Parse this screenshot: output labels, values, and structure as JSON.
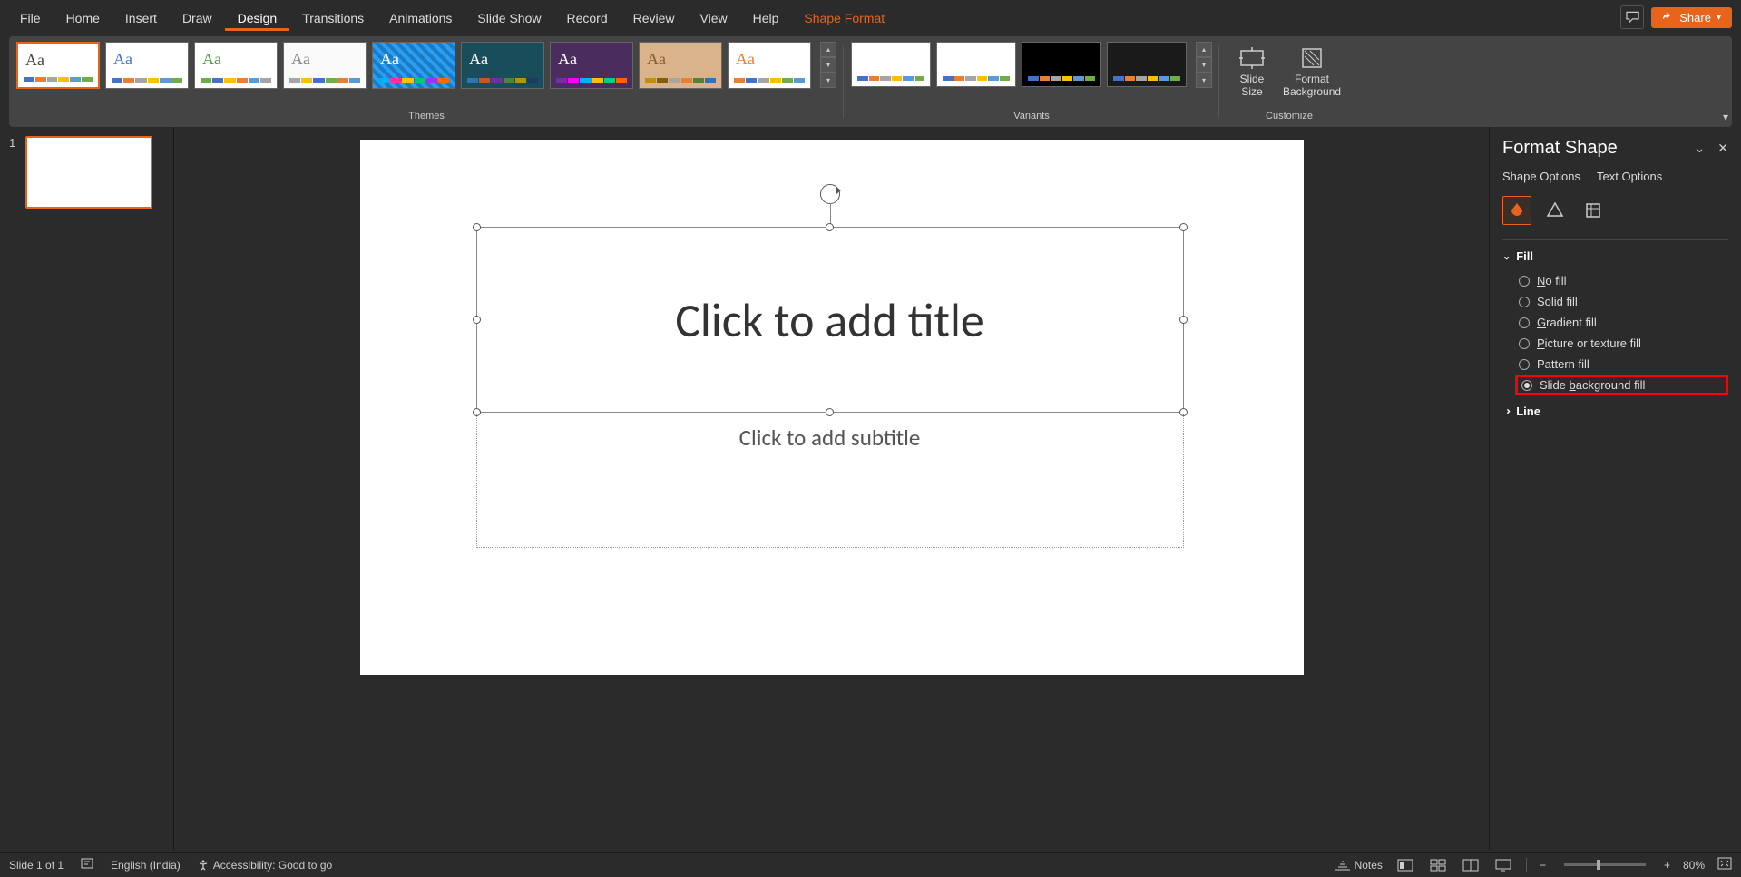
{
  "menu": {
    "items": [
      "File",
      "Home",
      "Insert",
      "Draw",
      "Design",
      "Transitions",
      "Animations",
      "Slide Show",
      "Record",
      "Review",
      "View",
      "Help",
      "Shape Format"
    ],
    "active": "Design",
    "accent": "Shape Format"
  },
  "share_label": "Share",
  "ribbon": {
    "themes_label": "Themes",
    "variants_label": "Variants",
    "customize_label": "Customize",
    "slide_size": "Slide\nSize",
    "format_bg": "Format\nBackground"
  },
  "thumbnails": [
    {
      "num": "1"
    }
  ],
  "slide": {
    "title_placeholder": "Click to add title",
    "subtitle_placeholder": "Click to add subtitle"
  },
  "pane": {
    "title": "Format Shape",
    "tabs": [
      "Shape Options",
      "Text Options"
    ],
    "fill": {
      "label": "Fill",
      "options": [
        "No fill",
        "Solid fill",
        "Gradient fill",
        "Picture or texture fill",
        "Pattern fill",
        "Slide background fill"
      ],
      "selected": "Slide background fill"
    },
    "line": {
      "label": "Line"
    }
  },
  "status": {
    "slide_info": "Slide 1 of 1",
    "language": "English (India)",
    "accessibility": "Accessibility: Good to go",
    "notes": "Notes",
    "zoom": "80%"
  },
  "theme_colors": [
    [
      "#4472c4",
      "#ed7d31",
      "#a5a5a5",
      "#ffc000",
      "#5b9bd5",
      "#70ad47"
    ],
    [
      "#4472c4",
      "#ed7d31",
      "#a5a5a5",
      "#ffc000",
      "#5b9bd5",
      "#70ad47"
    ],
    [
      "#70ad47",
      "#4472c4",
      "#ffc000",
      "#ed7d31",
      "#5b9bd5",
      "#a5a5a5"
    ],
    [
      "#a5a5a5",
      "#ffc000",
      "#4472c4",
      "#70ad47",
      "#ed7d31",
      "#5b9bd5"
    ],
    [
      "#00b0f0",
      "#ff3399",
      "#ffc000",
      "#00cc66",
      "#9933ff",
      "#ff6600"
    ],
    [
      "#2e75b6",
      "#c55a11",
      "#7030a0",
      "#548235",
      "#bf9000",
      "#1f3864"
    ],
    [
      "#7030a0",
      "#ff00ff",
      "#00b0f0",
      "#ffc000",
      "#00cc99",
      "#ff6600"
    ],
    [
      "#bf8f00",
      "#806000",
      "#a5a5a5",
      "#ed7d31",
      "#548235",
      "#2e75b6"
    ],
    [
      "#ed7d31",
      "#4472c4",
      "#a5a5a5",
      "#ffc000",
      "#70ad47",
      "#5b9bd5"
    ]
  ],
  "variant_bgs": [
    "#ffffff",
    "#ffffff",
    "#000000",
    "#1a1a1a"
  ]
}
